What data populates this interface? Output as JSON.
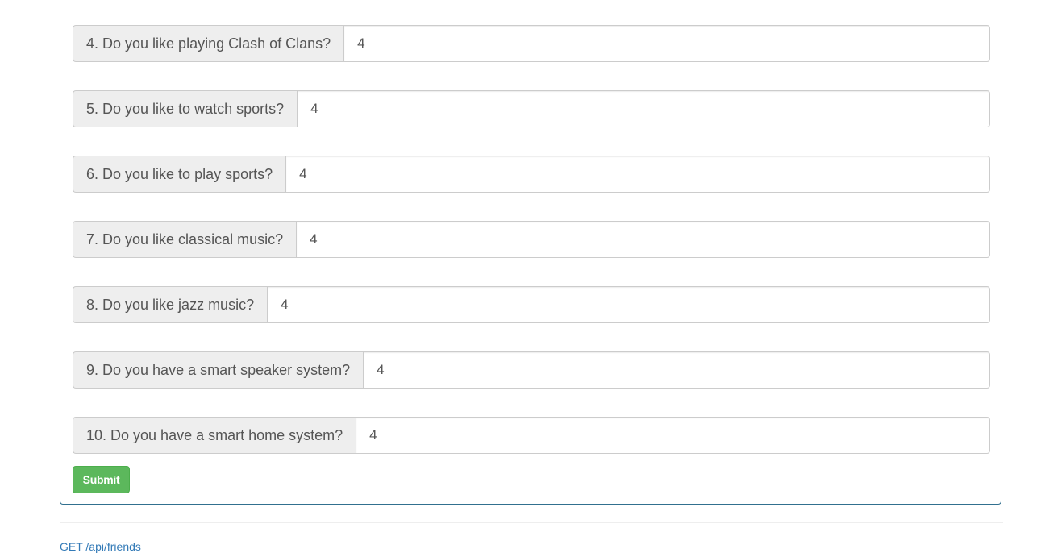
{
  "survey": {
    "questions": [
      {
        "label": "4. Do you like playing Clash of Clans?",
        "value": "4"
      },
      {
        "label": "5. Do you like to watch sports?",
        "value": "4"
      },
      {
        "label": "6. Do you like to play sports?",
        "value": "4"
      },
      {
        "label": "7. Do you like classical music?",
        "value": "4"
      },
      {
        "label": "8. Do you like jazz music?",
        "value": "4"
      },
      {
        "label": "9. Do you have a smart speaker system?",
        "value": "4"
      },
      {
        "label": "10. Do you have a smart home system?",
        "value": "4"
      }
    ],
    "submit_label": "Submit"
  },
  "footer": {
    "api_link": "GET /api/friends"
  },
  "colors": {
    "panel_border": "#31708f",
    "submit_bg": "#5cb85c",
    "link": "#337ab7"
  }
}
